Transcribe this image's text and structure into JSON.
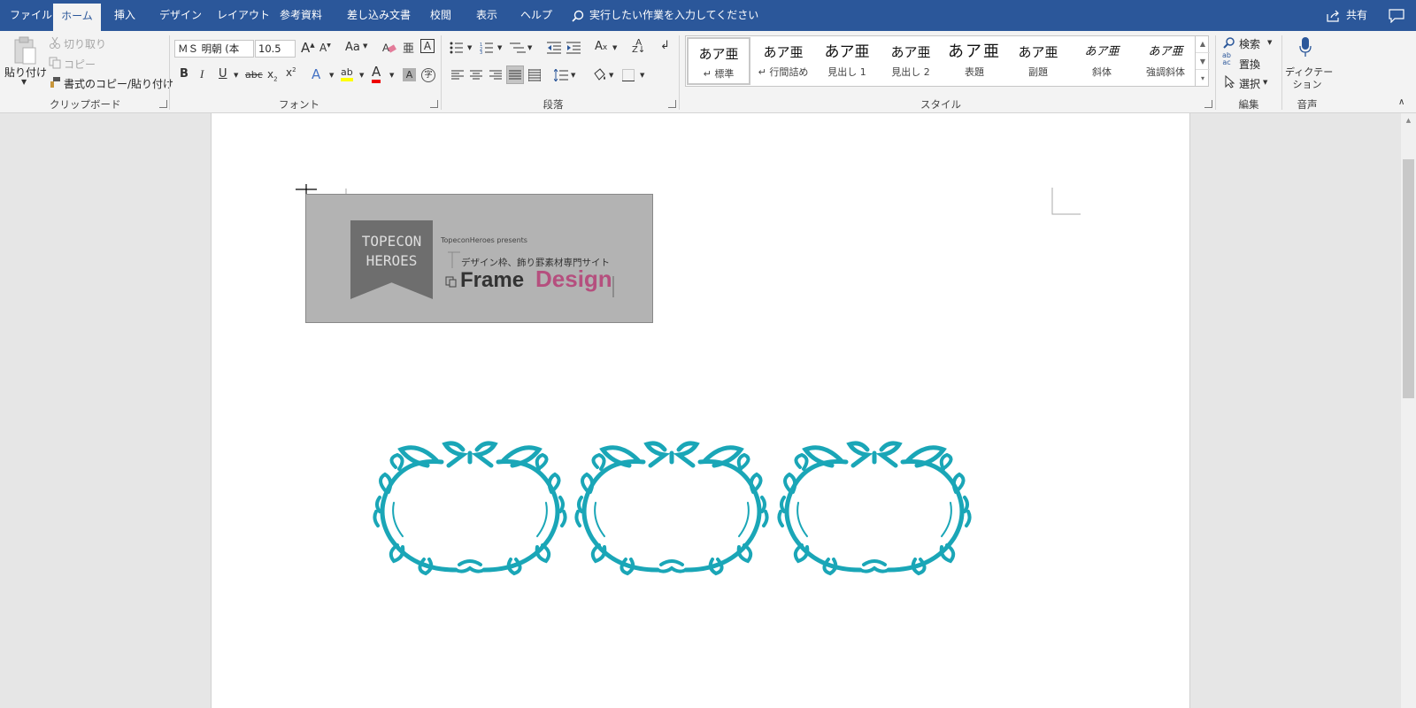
{
  "tabs": [
    "ファイル",
    "ホーム",
    "挿入",
    "デザイン",
    "レイアウト",
    "参考資料",
    "差し込み文書",
    "校閲",
    "表示",
    "ヘルプ"
  ],
  "active_tab": "ホーム",
  "tell_me": "実行したい作業を入力してください",
  "share": "共有",
  "clipboard": {
    "paste": "貼り付け",
    "cut": "切り取り",
    "copy": "コピー",
    "format_painter": "書式のコピー/貼り付け",
    "label": "クリップボード"
  },
  "font": {
    "name": "ＭＳ 明朝 (本",
    "size": "10.5",
    "label": "フォント",
    "aa": "Aa"
  },
  "paragraph": {
    "label": "段落"
  },
  "styles": {
    "label": "スタイル",
    "items": [
      {
        "preview": "あア亜",
        "name": "↵ 標準"
      },
      {
        "preview": "あア亜",
        "name": "↵ 行間詰め"
      },
      {
        "preview": "あア亜",
        "name": "見出し 1"
      },
      {
        "preview": "あア亜",
        "name": "見出し 2"
      },
      {
        "preview": "あア亜",
        "name": "表題"
      },
      {
        "preview": "あア亜",
        "name": "副題"
      },
      {
        "preview": "あア亜",
        "name": "斜体"
      },
      {
        "preview": "あア亜",
        "name": "強調斜体"
      }
    ]
  },
  "editing": {
    "find": "検索",
    "replace": "置換",
    "select": "選択",
    "label": "編集"
  },
  "voice": {
    "dictate": "ディクテー",
    "dictate2": "ション",
    "label": "音声"
  },
  "banner": {
    "flag1": "TOPECON",
    "flag2": "HEROES",
    "presents": "TopeconHeroes presents",
    "jp": "デザイン枠、飾り罫素材専門サイト",
    "frame": "Frame",
    "design": "Design"
  },
  "frames": [
    {
      "color": "#1aa6b7",
      "icon": "ornamental-frame"
    },
    {
      "color": "#000000",
      "icon": "ornamental-frame"
    },
    {
      "color": "#f07583",
      "icon": "ornamental-frame"
    }
  ]
}
